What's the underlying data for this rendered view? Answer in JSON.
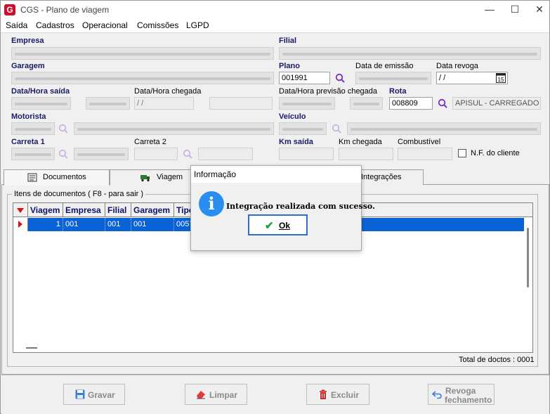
{
  "window": {
    "title": "CGS - Plano de viagem",
    "logo_letter": "G"
  },
  "window_controls": {
    "minimize": "—",
    "maximize": "☐",
    "close": "✕"
  },
  "menu": [
    "Saída",
    "Cadastros",
    "Operacional",
    "Comissões",
    "LGPD"
  ],
  "form": {
    "empresa_label": "Empresa",
    "filial_label": "Filial",
    "garagem_label": "Garagem",
    "plano_label": "Plano",
    "plano_value": "001991",
    "data_emissao_label": "Data de emissão",
    "data_revoga_label": "Data revoga",
    "data_revoga_value": " / /",
    "data_hora_saida_label": "Data/Hora saída",
    "data_hora_chegada_label": "Data/Hora chegada",
    "data_hora_chegada_value": "  / /",
    "data_hora_prev_label": "Data/Hora previsão chegada",
    "rota_label": "Rota",
    "rota_value": "008809",
    "rota_desc": "APISUL - CARREGADO - ",
    "motorista_label": "Motorista",
    "veiculo_label": "Veículo",
    "carreta1_label": "Carreta 1",
    "carreta2_label": "Carreta 2",
    "km_saida_label": "Km saída",
    "km_chegada_label": "Km chegada",
    "combustivel_label": "Combustível",
    "nf_cliente_label": "N.F. do cliente"
  },
  "tabs": [
    "Documentos",
    "Viagem",
    "Integrações"
  ],
  "documents": {
    "group_title": "Itens de documentos ( F8 - para sair )",
    "columns": [
      "Viagem",
      "Empresa",
      "Filial",
      "Garagem",
      "Tipo"
    ],
    "rows": [
      {
        "viagem": "1",
        "empresa": "001",
        "filial": "001",
        "garagem": "001",
        "tipo": "0057"
      }
    ],
    "total_label": "Total de doctos : 0001"
  },
  "buttons": {
    "gravar": "Gravar",
    "limpar": "Limpar",
    "excluir": "Excluir",
    "revoga_line1": "Revoga",
    "revoga_line2": "fechamento"
  },
  "dialog": {
    "title": "Informação",
    "icon": "info-icon",
    "message": "Integração realizada com sucesso.",
    "ok_label": "Ok"
  },
  "colors": {
    "selection": "#0a63d6",
    "header_text": "#10106a",
    "brand": "#c8102e",
    "info": "#2a8ef0"
  }
}
